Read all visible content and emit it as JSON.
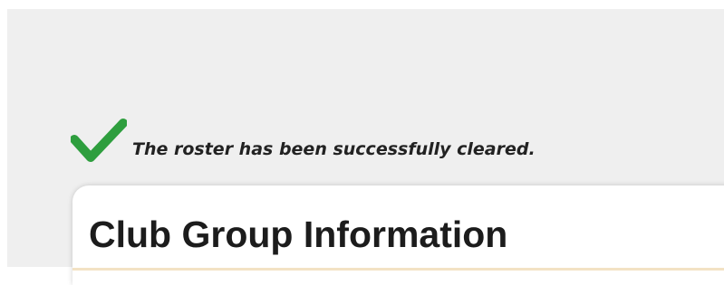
{
  "status": {
    "icon": "checkmark-icon",
    "icon_color": "#2e9e3e",
    "message": "The roster has been successfully cleared."
  },
  "card": {
    "title": "Club Group Information",
    "accent_color": "#f3e2c4"
  }
}
